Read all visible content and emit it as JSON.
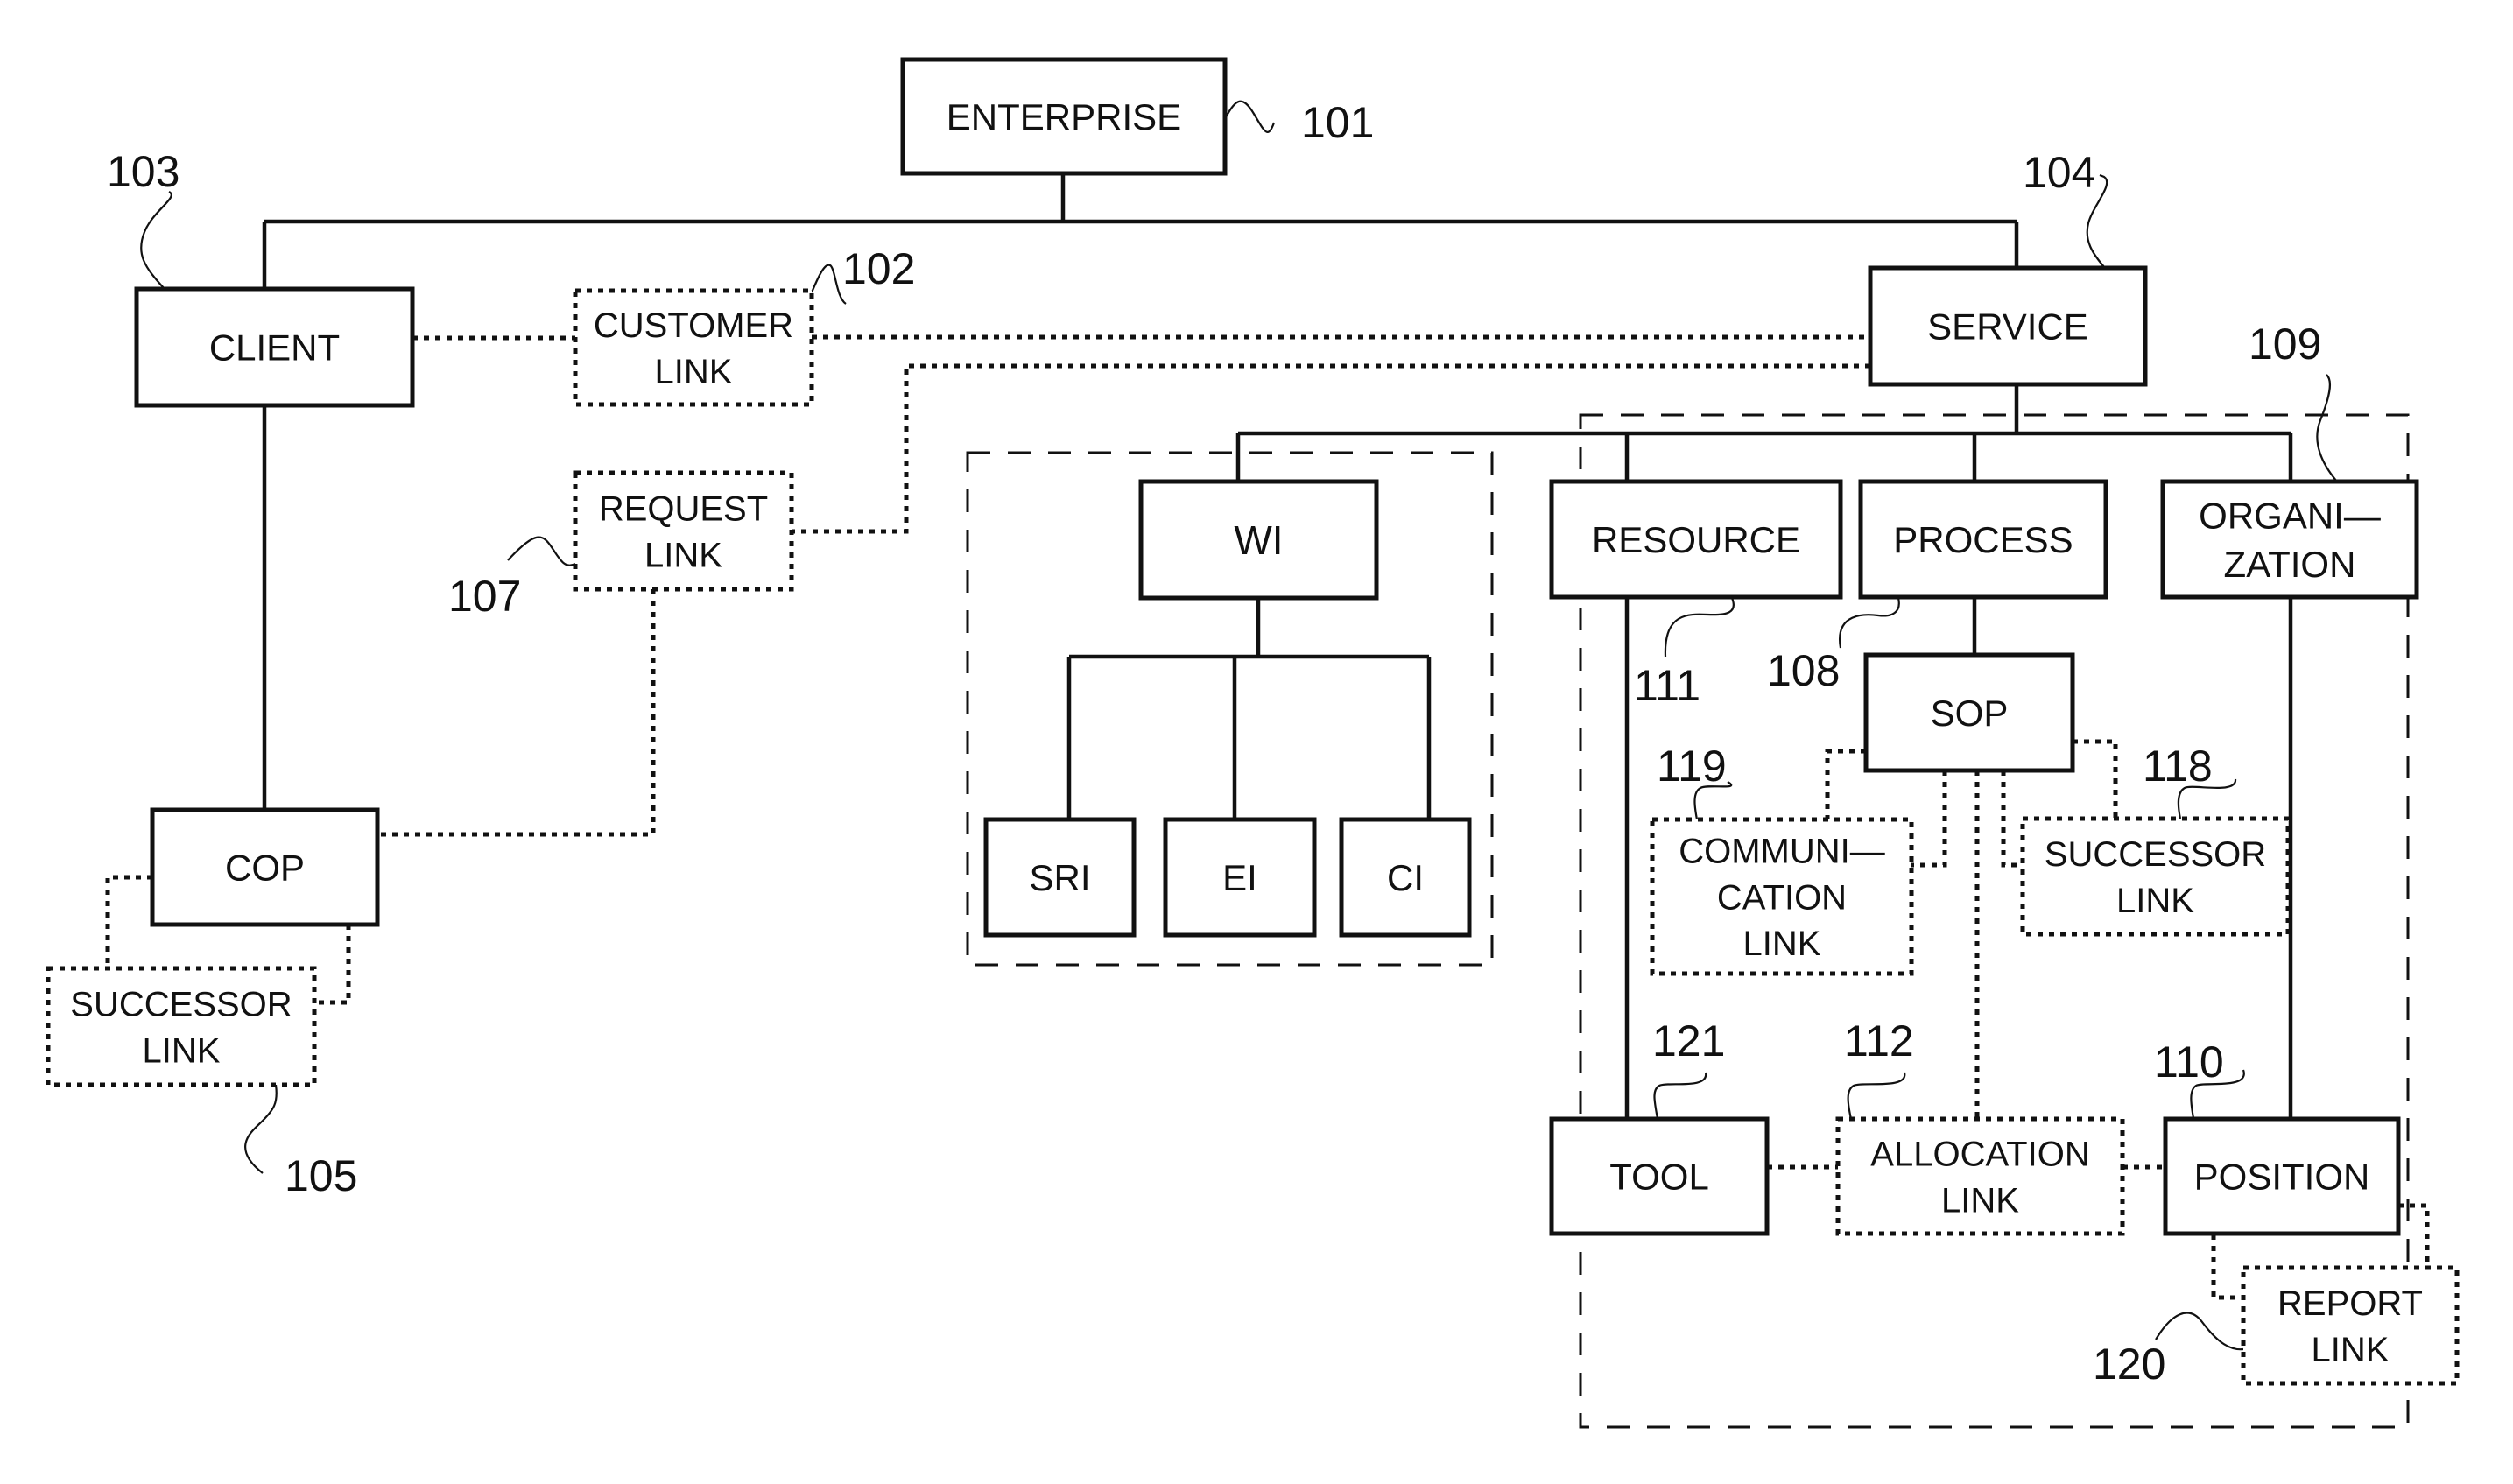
{
  "figure": {
    "nodes": {
      "enterprise": {
        "lines": [
          "ENTERPRISE"
        ],
        "ref": "101",
        "style": "solid"
      },
      "customer_link": {
        "lines": [
          "CUSTOMER",
          "LINK"
        ],
        "ref": "102",
        "style": "dotted"
      },
      "client": {
        "lines": [
          "CLIENT"
        ],
        "ref": "103",
        "style": "solid"
      },
      "service": {
        "lines": [
          "SERVICE"
        ],
        "ref": "104",
        "style": "solid"
      },
      "cop": {
        "lines": [
          "COP"
        ],
        "ref": "",
        "style": "solid"
      },
      "cop_successor_link": {
        "lines": [
          "SUCCESSOR",
          "LINK"
        ],
        "ref": "105",
        "style": "dotted"
      },
      "request_link": {
        "lines": [
          "REQUEST",
          "LINK"
        ],
        "ref": "107",
        "style": "dotted"
      },
      "wi": {
        "lines": [
          "WI"
        ],
        "ref": "",
        "style": "solid"
      },
      "sri": {
        "lines": [
          "SRI"
        ],
        "ref": "",
        "style": "solid"
      },
      "ei": {
        "lines": [
          "EI"
        ],
        "ref": "",
        "style": "solid"
      },
      "ci": {
        "lines": [
          "CI"
        ],
        "ref": "",
        "style": "solid"
      },
      "resource": {
        "lines": [
          "RESOURCE"
        ],
        "ref": "111",
        "style": "solid"
      },
      "process": {
        "lines": [
          "PROCESS"
        ],
        "ref": "108",
        "style": "solid"
      },
      "organization": {
        "lines": [
          "ORGANI—",
          "ZATION"
        ],
        "ref": "109",
        "style": "solid"
      },
      "sop": {
        "lines": [
          "SOP"
        ],
        "ref": "",
        "style": "solid"
      },
      "communication_link": {
        "lines": [
          "COMMUNI—",
          "CATION",
          "LINK"
        ],
        "ref": "119",
        "style": "dotted"
      },
      "sop_successor_link": {
        "lines": [
          "SUCCESSOR",
          "LINK"
        ],
        "ref": "118",
        "style": "dotted"
      },
      "tool": {
        "lines": [
          "TOOL"
        ],
        "ref": "121",
        "style": "solid"
      },
      "allocation_link": {
        "lines": [
          "ALLOCATION",
          "LINK"
        ],
        "ref": "112",
        "style": "dotted"
      },
      "position": {
        "lines": [
          "POSITION"
        ],
        "ref": "110",
        "style": "solid"
      },
      "report_link": {
        "lines": [
          "REPORT",
          "LINK"
        ],
        "ref": "120",
        "style": "dotted"
      }
    },
    "edges": [
      {
        "from": "enterprise",
        "to": "client",
        "kind": "solid"
      },
      {
        "from": "enterprise",
        "to": "service",
        "kind": "solid"
      },
      {
        "from": "client",
        "to": "cop",
        "kind": "solid"
      },
      {
        "from": "client",
        "to": "customer_link",
        "kind": "dotted"
      },
      {
        "from": "customer_link",
        "to": "service",
        "kind": "dotted"
      },
      {
        "from": "service",
        "to": "request_link",
        "kind": "dotted"
      },
      {
        "from": "request_link",
        "to": "cop",
        "kind": "dotted"
      },
      {
        "from": "cop",
        "to": "cop_successor_link",
        "kind": "dotted"
      },
      {
        "from": "service",
        "to": "wi",
        "kind": "solid"
      },
      {
        "from": "service",
        "to": "resource",
        "kind": "solid"
      },
      {
        "from": "service",
        "to": "process",
        "kind": "solid"
      },
      {
        "from": "service",
        "to": "organization",
        "kind": "solid"
      },
      {
        "from": "wi",
        "to": "sri",
        "kind": "solid"
      },
      {
        "from": "wi",
        "to": "ei",
        "kind": "solid"
      },
      {
        "from": "wi",
        "to": "ci",
        "kind": "solid"
      },
      {
        "from": "process",
        "to": "sop",
        "kind": "solid"
      },
      {
        "from": "resource",
        "to": "tool",
        "kind": "solid"
      },
      {
        "from": "organization",
        "to": "position",
        "kind": "solid"
      },
      {
        "from": "sop",
        "to": "communication_link",
        "kind": "dotted"
      },
      {
        "from": "sop",
        "to": "sop_successor_link",
        "kind": "dotted"
      },
      {
        "from": "sop",
        "to": "allocation_link",
        "kind": "dotted"
      },
      {
        "from": "tool",
        "to": "allocation_link",
        "kind": "dotted"
      },
      {
        "from": "allocation_link",
        "to": "position",
        "kind": "dotted"
      },
      {
        "from": "position",
        "to": "report_link",
        "kind": "dotted"
      }
    ],
    "groups": [
      {
        "id": "wi_group",
        "members": [
          "wi",
          "sri",
          "ei",
          "ci"
        ],
        "ref": ""
      },
      {
        "id": "service_group",
        "members": [
          "resource",
          "process",
          "organization",
          "sop",
          "tool",
          "allocation_link",
          "position"
        ],
        "ref": "109"
      }
    ]
  }
}
